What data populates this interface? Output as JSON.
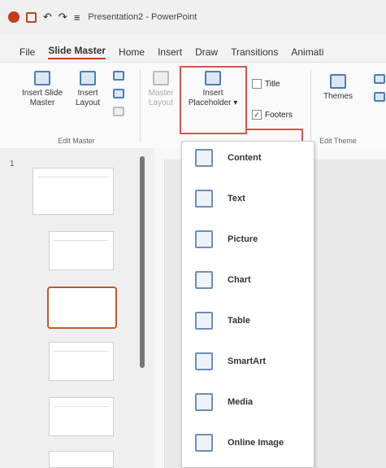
{
  "app": {
    "title": "Presentation2 - PowerPoint"
  },
  "quick_access": {
    "undo_glyph": "↶",
    "redo_glyph": "↷",
    "customize_glyph": "≡"
  },
  "tabs": [
    "File",
    "Slide Master",
    "Home",
    "Insert",
    "Draw",
    "Transitions",
    "Animati"
  ],
  "active_tab": "Slide Master",
  "ribbon": {
    "edit_master": {
      "insert_slide_master": "Insert Slide Master",
      "insert_layout": "Insert Layout",
      "label": "Edit Master"
    },
    "master_layout": {
      "label": "Master Layout"
    },
    "insert_placeholder": {
      "label": "Insert Placeholder ▾"
    },
    "checks": {
      "title": "Title",
      "footers": "Footers",
      "footers_checked": "✓"
    },
    "themes": {
      "label": "Themes",
      "group_label": "Edit Theme"
    }
  },
  "thumbnails": {
    "first_number": "1"
  },
  "menu": {
    "items": [
      "Content",
      "Text",
      "Picture",
      "Chart",
      "Table",
      "SmartArt",
      "Media",
      "Online Image"
    ]
  },
  "colors": {
    "accent": "#c43e1c",
    "highlight_border": "#d9534f",
    "icon_blue": "#4a7fb5"
  }
}
